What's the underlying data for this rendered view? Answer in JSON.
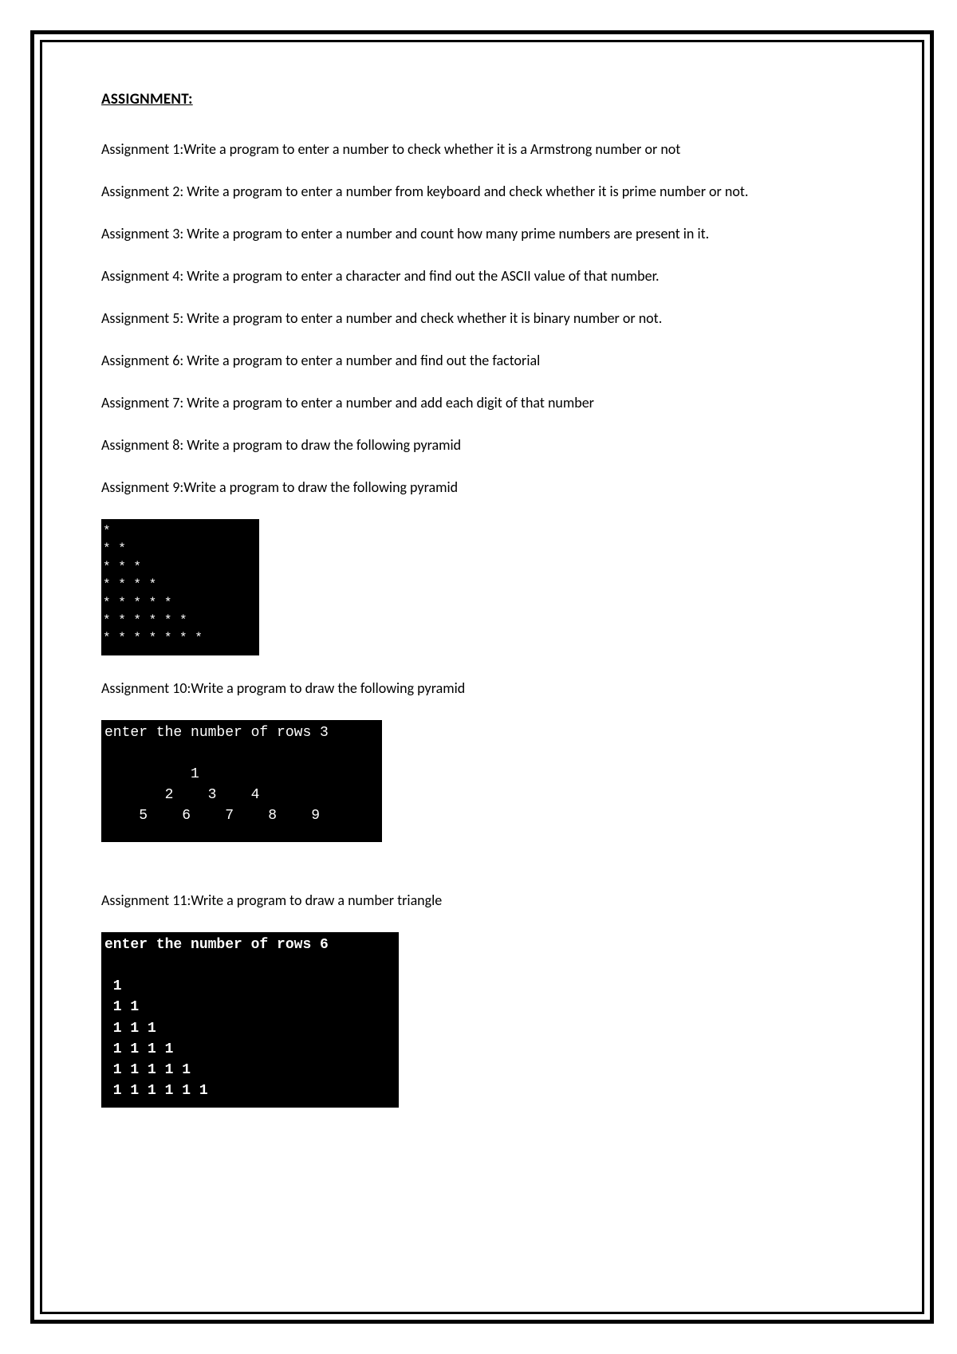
{
  "heading": "ASSIGNMENT:",
  "assignments": {
    "a1": "Assignment 1:Write a program to enter a number to check whether it is a Armstrong number or not",
    "a2": "Assignment 2: Write a program to enter a number from keyboard and check whether it is prime number or not.",
    "a3": "Assignment 3: Write a program to enter a number and count how many prime numbers are present in it.",
    "a4": "Assignment 4: Write a program to enter a character and find out the ASCII value of that number.",
    "a5": "Assignment 5: Write a program to enter a number and check whether it is binary number or not.",
    "a6": "Assignment 6: Write a program to enter a number and find out the factorial",
    "a7": "Assignment 7: Write a program to enter a number and add each digit of that number",
    "a8": "Assignment 8: Write a program to draw the following pyramid",
    "a9": "Assignment 9:Write a program to draw the following pyramid",
    "a10": "Assignment 10:Write a program to draw the following pyramid",
    "a11": "Assignment 11:Write a program to draw a number triangle"
  },
  "code_blocks": {
    "block1": "*\n* *\n* * *\n* * * *\n* * * * *\n* * * * * *\n* * * * * * *",
    "block2": "enter the number of rows 3\n\n          1\n       2    3    4\n    5    6    7    8    9",
    "block3": "enter the number of rows 6\n\n 1\n 1 1\n 1 1 1\n 1 1 1 1\n 1 1 1 1 1\n 1 1 1 1 1 1"
  }
}
